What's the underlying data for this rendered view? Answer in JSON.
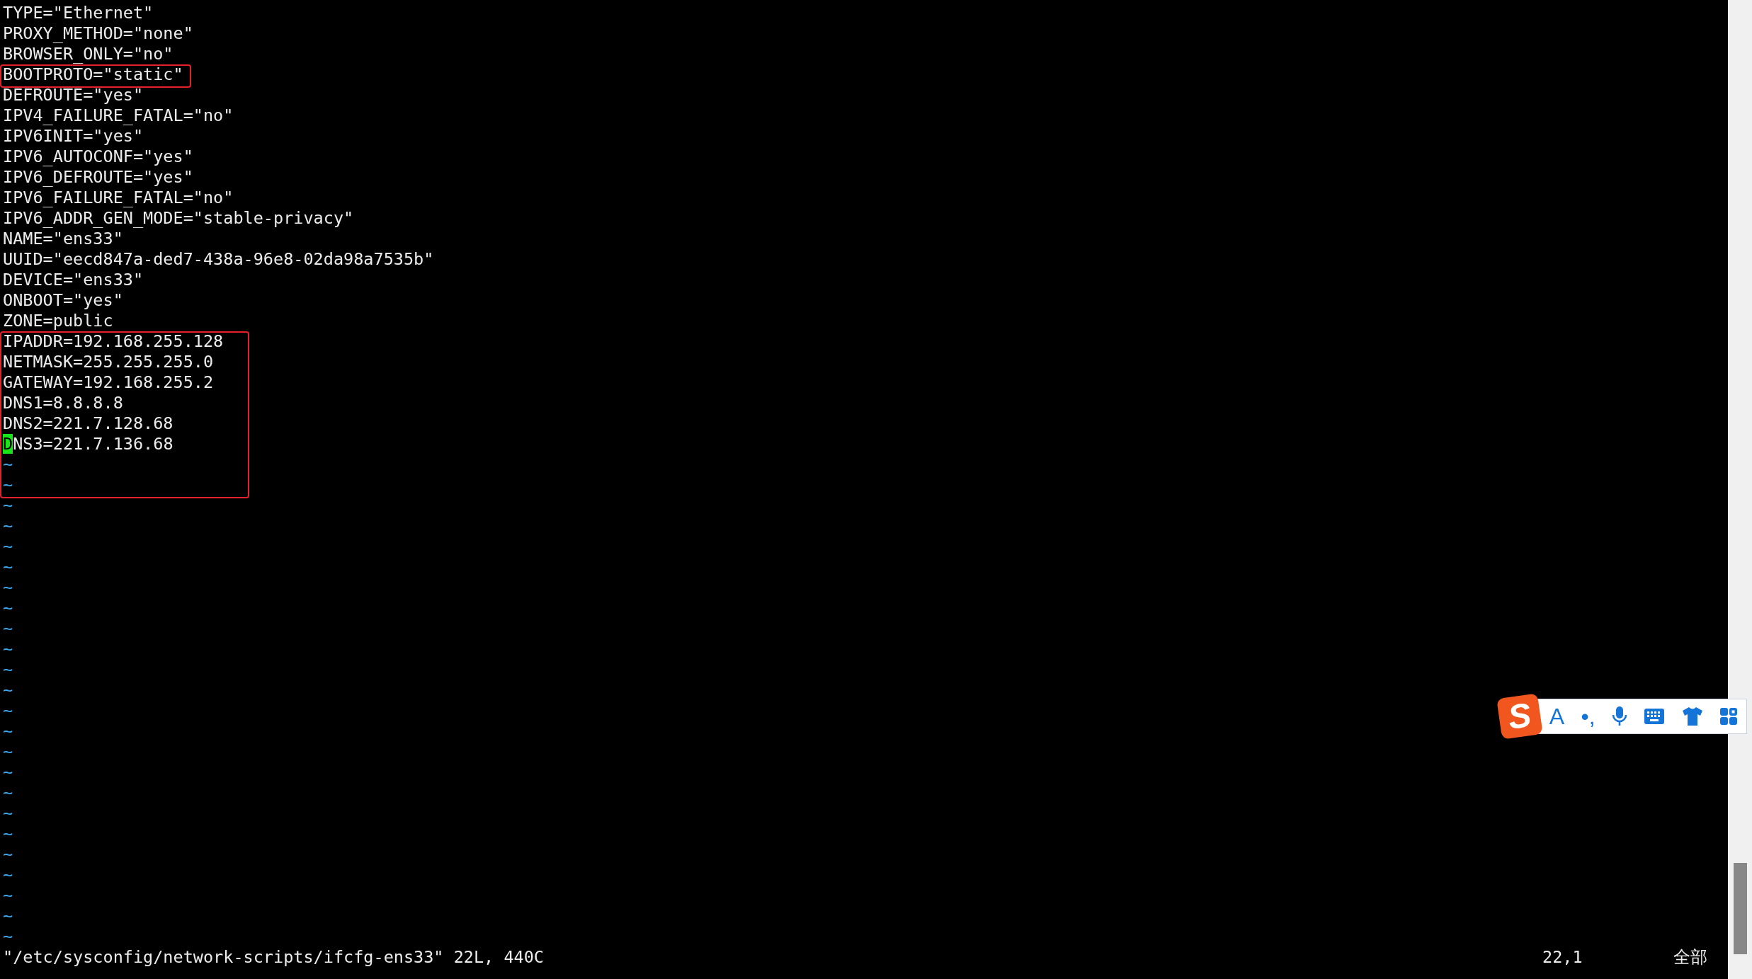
{
  "buffer": [
    {
      "boxed": false,
      "lines": [
        {
          "kind": "text",
          "text": "TYPE=\"Ethernet\"",
          "cursor": false
        },
        {
          "kind": "text",
          "text": "PROXY_METHOD=\"none\"",
          "cursor": false
        },
        {
          "kind": "text",
          "text": "BROWSER_ONLY=\"no\"",
          "cursor": false
        }
      ]
    },
    {
      "boxed": true,
      "lines": [
        {
          "kind": "text",
          "text": "BOOTPROTO=\"static\"",
          "cursor": false
        }
      ]
    },
    {
      "boxed": false,
      "lines": [
        {
          "kind": "text",
          "text": "DEFROUTE=\"yes\"",
          "cursor": false
        },
        {
          "kind": "text",
          "text": "IPV4_FAILURE_FATAL=\"no\"",
          "cursor": false
        },
        {
          "kind": "text",
          "text": "IPV6INIT=\"yes\"",
          "cursor": false
        },
        {
          "kind": "text",
          "text": "IPV6_AUTOCONF=\"yes\"",
          "cursor": false
        },
        {
          "kind": "text",
          "text": "IPV6_DEFROUTE=\"yes\"",
          "cursor": false
        },
        {
          "kind": "text",
          "text": "IPV6_FAILURE_FATAL=\"no\"",
          "cursor": false
        },
        {
          "kind": "text",
          "text": "IPV6_ADDR_GEN_MODE=\"stable-privacy\"",
          "cursor": false
        },
        {
          "kind": "text",
          "text": "NAME=\"ens33\"",
          "cursor": false
        },
        {
          "kind": "text",
          "text": "UUID=\"eecd847a-ded7-438a-96e8-02da98a7535b\"",
          "cursor": false
        },
        {
          "kind": "text",
          "text": "DEVICE=\"ens33\"",
          "cursor": false
        },
        {
          "kind": "text",
          "text": "ONBOOT=\"yes\"",
          "cursor": false
        },
        {
          "kind": "text",
          "text": "ZONE=public",
          "cursor": false
        }
      ]
    },
    {
      "boxed": true,
      "lines": [
        {
          "kind": "text",
          "text": "IPADDR=192.168.255.128",
          "cursor": false
        },
        {
          "kind": "text",
          "text": "NETMASK=255.255.255.0",
          "cursor": false
        },
        {
          "kind": "text",
          "text": "GATEWAY=192.168.255.2",
          "cursor": false
        },
        {
          "kind": "text",
          "text": "DNS1=8.8.8.8",
          "cursor": false
        },
        {
          "kind": "text",
          "text": "DNS2=221.7.128.68",
          "cursor": false
        },
        {
          "kind": "text",
          "text": "DNS3=221.7.136.68",
          "cursor": true
        },
        {
          "kind": "filler",
          "text": "~",
          "cursor": false
        },
        {
          "kind": "filler",
          "text": "~",
          "cursor": false
        }
      ]
    },
    {
      "boxed": false,
      "lines": [
        {
          "kind": "filler",
          "text": "~",
          "cursor": false
        },
        {
          "kind": "filler",
          "text": "~",
          "cursor": false
        },
        {
          "kind": "filler",
          "text": "~",
          "cursor": false
        },
        {
          "kind": "filler",
          "text": "~",
          "cursor": false
        },
        {
          "kind": "filler",
          "text": "~",
          "cursor": false
        },
        {
          "kind": "filler",
          "text": "~",
          "cursor": false
        },
        {
          "kind": "filler",
          "text": "~",
          "cursor": false
        },
        {
          "kind": "filler",
          "text": "~",
          "cursor": false
        },
        {
          "kind": "filler",
          "text": "~",
          "cursor": false
        },
        {
          "kind": "filler",
          "text": "~",
          "cursor": false
        },
        {
          "kind": "filler",
          "text": "~",
          "cursor": false
        },
        {
          "kind": "filler",
          "text": "~",
          "cursor": false
        },
        {
          "kind": "filler",
          "text": "~",
          "cursor": false
        },
        {
          "kind": "filler",
          "text": "~",
          "cursor": false
        },
        {
          "kind": "filler",
          "text": "~",
          "cursor": false
        },
        {
          "kind": "filler",
          "text": "~",
          "cursor": false
        },
        {
          "kind": "filler",
          "text": "~",
          "cursor": false
        },
        {
          "kind": "filler",
          "text": "~",
          "cursor": false
        },
        {
          "kind": "filler",
          "text": "~",
          "cursor": false
        },
        {
          "kind": "filler",
          "text": "~",
          "cursor": false
        },
        {
          "kind": "filler",
          "text": "~",
          "cursor": false
        },
        {
          "kind": "filler",
          "text": "~",
          "cursor": false
        }
      ]
    }
  ],
  "status_bar": {
    "message": "\"/etc/sysconfig/network-scripts/ifcfg-ens33\" 22L, 440C",
    "ruler": "22,1",
    "position": "全部"
  },
  "ime_toolbar": {
    "logo": "S",
    "items": [
      {
        "kind": "text",
        "label": "A"
      },
      {
        "kind": "text",
        "label": "•,"
      },
      {
        "kind": "mic"
      },
      {
        "kind": "keyboard"
      },
      {
        "kind": "shirt"
      },
      {
        "kind": "grid"
      }
    ]
  }
}
